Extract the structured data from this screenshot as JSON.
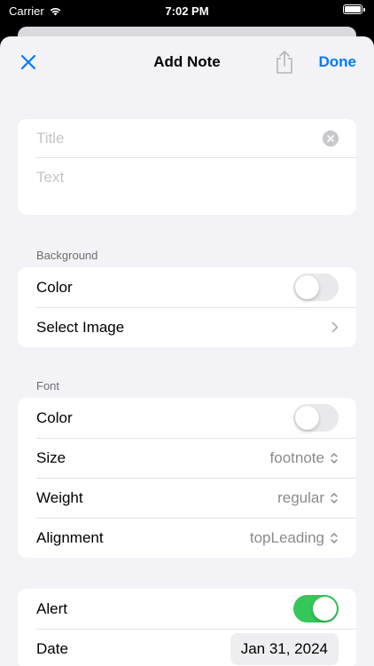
{
  "status_bar": {
    "carrier": "Carrier",
    "time": "7:02 PM"
  },
  "nav": {
    "title": "Add Note",
    "done_label": "Done",
    "close_icon": "xmark-icon",
    "share_icon": "share-icon"
  },
  "note": {
    "title_placeholder": "Title",
    "text_placeholder": "Text"
  },
  "background": {
    "header": "Background",
    "color_label": "Color",
    "color_on": false,
    "select_image_label": "Select Image"
  },
  "font": {
    "header": "Font",
    "color_label": "Color",
    "color_on": false,
    "size_label": "Size",
    "size_value": "footnote",
    "weight_label": "Weight",
    "weight_value": "regular",
    "alignment_label": "Alignment",
    "alignment_value": "topLeading"
  },
  "alert": {
    "alert_label": "Alert",
    "alert_on": true,
    "date_label": "Date",
    "date_value": "Jan 31, 2024"
  },
  "colors": {
    "accent": "#007aff",
    "toggle_on": "#34c759",
    "background": "#f2f2f7"
  }
}
